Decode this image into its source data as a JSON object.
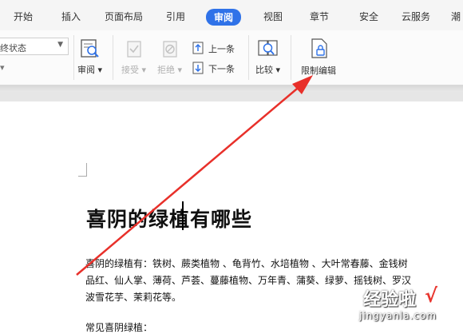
{
  "tabs": [
    {
      "label": "开始"
    },
    {
      "label": "插入"
    },
    {
      "label": "页面布局"
    },
    {
      "label": "引用"
    },
    {
      "label": "审阅",
      "active": true
    },
    {
      "label": "视图"
    },
    {
      "label": "章节"
    },
    {
      "label": "安全"
    },
    {
      "label": "云服务"
    },
    {
      "label": "潮"
    }
  ],
  "toolbar": {
    "status_select_value": "终状态",
    "review_label": "审阅",
    "accept_label": "接受",
    "reject_label": "拒绝",
    "prev_label": "上一条",
    "next_label": "下一条",
    "compare_label": "比较",
    "restrict_label": "限制编辑"
  },
  "document": {
    "title": "喜阴的绿植有哪些",
    "lines": [
      "喜阴的绿植有：铁树、蕨类植物 、龟背竹、水培植物 、大叶常春藤、金钱树",
      "品红、仙人掌、薄荷、芦荟、蔓藤植物、万年青、蒲葵、绿萝、摇钱树、罗汉",
      "波雪花芋、茉莉花等。",
      "常见喜阴绿植："
    ]
  },
  "watermark": {
    "text": "经验啦",
    "check": "√",
    "url": "jingyanla.com"
  },
  "colors": {
    "accent": "#2f72e8",
    "arrow": "#e8302a",
    "watermark_check": "#e8352e"
  }
}
